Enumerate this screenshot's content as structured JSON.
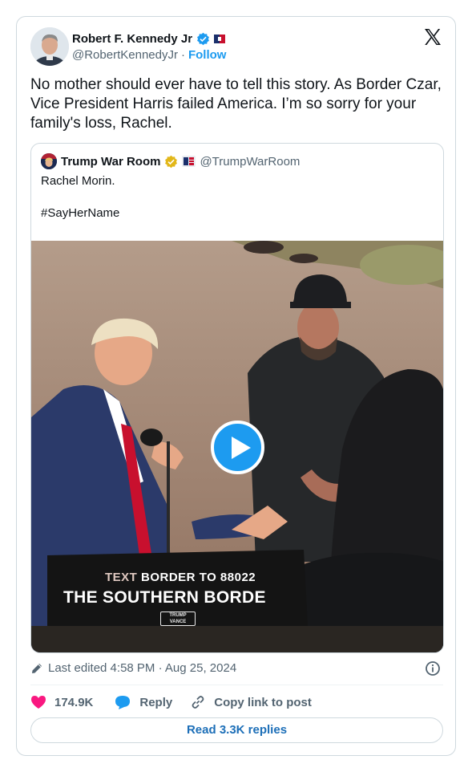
{
  "author": {
    "name": "Robert F. Kennedy Jr",
    "handle": "@RobertKennedyJr",
    "separator": "·",
    "follow_label": "Follow"
  },
  "tweet": {
    "text": "No mother should ever have to tell this story. As Border Czar, Vice President Harris failed America. I’m so sorry for your family's loss, Rachel."
  },
  "quote": {
    "name": "Trump War Room",
    "handle": "@TrumpWarRoom",
    "line1": "Rachel Morin.",
    "line2": "#SayHerName",
    "video": {
      "podium_text_a": "TEXT",
      "podium_text_b": "BORDER",
      "podium_text_c": "TO 88022",
      "podium_headline": "THE SOUTHERN BORDER",
      "podium_logo_top": "TRUMP",
      "podium_logo_bottom": "VANCE"
    }
  },
  "meta": {
    "edited": "Last edited 4:58 PM · Aug 25, 2024"
  },
  "actions": {
    "likes": "174.9K",
    "reply_label": "Reply",
    "copy_label": "Copy link to post"
  },
  "read_replies": "Read 3.3K replies",
  "colors": {
    "accent": "#1d9bf0",
    "like": "#f91880",
    "text": "#0f1419",
    "muted": "#536471",
    "border": "#cfd9de"
  },
  "icons": [
    "verified-badge-icon",
    "flag-icon",
    "x-logo-icon",
    "gold-verified-badge-icon",
    "play-icon",
    "pencil-icon",
    "info-icon",
    "heart-icon",
    "reply-bubble-icon",
    "link-icon"
  ]
}
